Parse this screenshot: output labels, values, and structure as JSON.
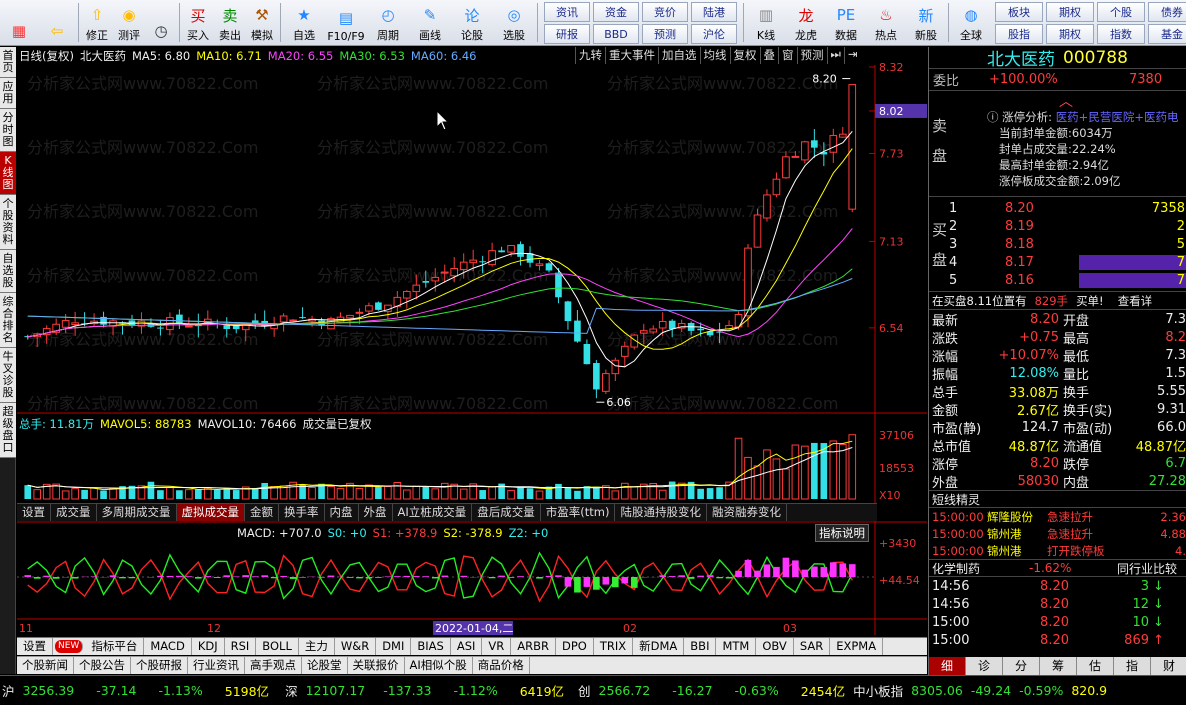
{
  "toolbar": {
    "buttons": [
      {
        "label": "",
        "icon": "grid-menu-icon"
      },
      {
        "label": "",
        "icon": "back-arrow-icon"
      },
      {
        "label": "修正",
        "icon": "up-arrow-icon"
      },
      {
        "label": "测评",
        "icon": "coin-icon"
      },
      {
        "label": "",
        "icon": "clock-icon"
      },
      {
        "label": "买入",
        "icon": "buy-icon"
      },
      {
        "label": "卖出",
        "icon": "sell-icon"
      },
      {
        "label": "模拟",
        "icon": "hammer-icon"
      },
      {
        "label": "自选",
        "icon": "star-icon"
      },
      {
        "label": "F10/F9",
        "icon": "window-icon"
      },
      {
        "label": "周期",
        "icon": "cycle-icon"
      },
      {
        "label": "画线",
        "icon": "pencil-icon"
      },
      {
        "label": "论股",
        "icon": "discuss-icon"
      },
      {
        "label": "选股",
        "icon": "select-stock-icon"
      }
    ],
    "grid": [
      [
        "资讯",
        "资金"
      ],
      [
        "研报",
        "BBD"
      ],
      [
        "竞价",
        "陆港"
      ],
      [
        "预测",
        "沪伦"
      ]
    ],
    "buttons2": [
      {
        "label": "K线",
        "icon": "kline-icon"
      },
      {
        "label": "龙虎",
        "icon": "dragon-icon"
      },
      {
        "label": "数据",
        "icon": "pe-icon"
      },
      {
        "label": "热点",
        "icon": "hot-icon"
      },
      {
        "label": "新股",
        "icon": "ipo-icon"
      },
      {
        "label": "全球",
        "icon": "globe-icon"
      }
    ],
    "grid2": [
      [
        "板块",
        "股指"
      ],
      [
        "个股",
        "指数"
      ],
      [
        "期权",
        "期权"
      ],
      [
        "债券",
        "基金"
      ]
    ]
  },
  "vtabs": [
    "首页",
    "应用",
    "分时图",
    "K线图",
    "个股资料",
    "自选股",
    "综合排名",
    "牛叉诊股",
    "超级盘口"
  ],
  "chart": {
    "title": "日线(复权)",
    "name": "北大医药",
    "ma5": "MA5: 6.80",
    "ma10": "MA10: 6.71",
    "ma20": "MA20: 6.55",
    "ma30": "MA30: 6.53",
    "ma60": "MA60: 6.46",
    "tools": [
      "九转",
      "重大事件",
      "加自选",
      "均线",
      "复权",
      "叠",
      "窗",
      "预测"
    ],
    "price_axis": [
      "8.32",
      "8.02",
      "7.73",
      "7.13",
      "6.54"
    ],
    "high_label": "8.20",
    "low_label": "6.06",
    "vol_header": "总手: 11.81万",
    "mavol5": "MAVOL5: 88783",
    "mavol10": "MAVOL10: 76466",
    "vol_note": "成交量已复权",
    "vol_axis": [
      "37106",
      "18553",
      "X10"
    ],
    "macd_header": "MACD: +707.0",
    "s0": "S0: +0",
    "s1": "S1: +378.9",
    "s2": "S2: -378.9",
    "z2": "Z2: +0",
    "macd_help": "指标说明",
    "macd_axis": [
      "+3430",
      "+44.54"
    ],
    "date_axis": [
      "11",
      "12",
      "2022-01-04,二",
      "02",
      "03"
    ],
    "watermark": "分析家公式网www.70822.Com"
  },
  "ind_tabs": [
    "设置",
    "成交量",
    "多周期成交量",
    "虚拟成交量",
    "金额",
    "换手率",
    "内盘",
    "外盘",
    "AI立桩成交量",
    "盘后成交量",
    "市盈率(ttm)",
    "陆股通持股变化",
    "融资融券变化"
  ],
  "btm_tabs": [
    "设置",
    "NEW",
    "指标平台",
    "MACD",
    "KDJ",
    "RSI",
    "BOLL",
    "主力",
    "W&R",
    "DMI",
    "BIAS",
    "ASI",
    "VR",
    "ARBR",
    "DPO",
    "TRIX",
    "新DMA",
    "BBI",
    "MTM",
    "OBV",
    "SAR",
    "EXPMA"
  ],
  "btm_tabs2": [
    "个股新闻",
    "个股公告",
    "个股研报",
    "行业资讯",
    "高手观点",
    "论股堂",
    "关联报价",
    "AI相似个股",
    "商品价格"
  ],
  "status": {
    "sh_label": "沪",
    "sh_val": "3256.39",
    "sh_chg": "-37.14",
    "sh_pct": "-1.13%",
    "sh_amt": "5198亿",
    "sz_label": "深",
    "sz_val": "12107.17",
    "sz_chg": "-137.33",
    "sz_pct": "-1.12%",
    "sz_amt": "6419亿",
    "cy_label": "创",
    "cy_val": "2566.72",
    "cy_chg": "-16.27",
    "cy_pct": "-0.63%",
    "cy_amt": "2454亿",
    "zx_label": "中小板指",
    "zx_val": "8305.06",
    "zx_chg": "-49.24",
    "zx_pct": "-0.59%",
    "zx_amt": "820.9"
  },
  "quote": {
    "name": "北大医药",
    "code": "000788",
    "weibi_label": "委比",
    "weibi": "+100.00%",
    "weibi_num": "7380",
    "zt_label": "涨停分析:",
    "zt_concept": "医药+民营医院+医药电",
    "zt_lines": [
      "当前封单金额:6034万",
      "封单占成交量:22.24%",
      "最高封单金额:2.94亿",
      "涨停板成交金额:2.09亿"
    ],
    "sell_label": "卖盘",
    "buy_label": "买盘",
    "buys": [
      [
        "1",
        "8.20",
        "7358"
      ],
      [
        "2",
        "8.19",
        "2"
      ],
      [
        "3",
        "8.18",
        "5"
      ],
      [
        "4",
        "8.17",
        "7"
      ],
      [
        "5",
        "8.16",
        "7"
      ]
    ],
    "bar_note": "在买盘8.11位置有",
    "bar_vol": "829手",
    "bar_tag": "买单!",
    "bar_link": "查看详",
    "stats": [
      [
        "最新",
        "8.20",
        "开盘",
        "7.3"
      ],
      [
        "涨跌",
        "+0.75",
        "最高",
        "8.2"
      ],
      [
        "涨幅",
        "+10.07%",
        "最低",
        "7.3"
      ],
      [
        "振幅",
        "12.08%",
        "量比",
        "1.5"
      ],
      [
        "总手",
        "33.08万",
        "换手",
        "5.55"
      ],
      [
        "金额",
        "2.67亿",
        "换手(实)",
        "9.31"
      ],
      [
        "市盈(静)",
        "124.7",
        "市盈(动)",
        "66.0"
      ],
      [
        "总市值",
        "48.87亿",
        "流通值",
        "48.87亿"
      ],
      [
        "涨停",
        "8.20",
        "跌停",
        "6.7"
      ],
      [
        "外盘",
        "58030",
        "内盘",
        "27.28"
      ]
    ],
    "sprite_title": "短线精灵",
    "sprites": [
      [
        "15:00:00",
        "辉隆股份",
        "急速拉升",
        "2.36"
      ],
      [
        "15:00:00",
        "锦州港",
        "急速拉升",
        "4.88"
      ],
      [
        "15:00:00",
        "锦州港",
        "打开跌停板",
        "4."
      ]
    ],
    "sector": "化学制药",
    "sector_pct": "-1.62%",
    "sector_cmp": "同行业比较",
    "ticks": [
      [
        "14:56",
        "8.20",
        "3"
      ],
      [
        "14:56",
        "8.20",
        "12"
      ],
      [
        "15:00",
        "8.20",
        "10"
      ],
      [
        "15:00",
        "8.20",
        "869"
      ]
    ],
    "bottom_tabs": [
      "细",
      "诊",
      "分",
      "筹",
      "估",
      "指",
      "财"
    ]
  },
  "colors": {
    "up": "#ff3b3b",
    "down": "#33e0e6",
    "ma5": "#ffffff",
    "ma10": "#ffff00",
    "ma20": "#ff44ff",
    "ma30": "#33e033",
    "ma60": "#66aaff"
  }
}
